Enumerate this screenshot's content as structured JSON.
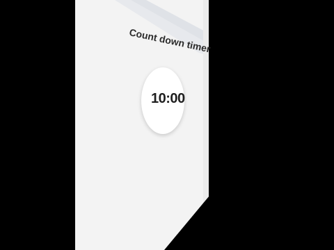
{
  "app": {
    "title": "Count down timer"
  },
  "timer": {
    "display": "10:00"
  },
  "colors": {
    "background": "#000000",
    "panel": "#f2f2f2",
    "header_bar": "#e6e8ec",
    "circle": "#ffffff",
    "text": "#2b2b2b"
  }
}
